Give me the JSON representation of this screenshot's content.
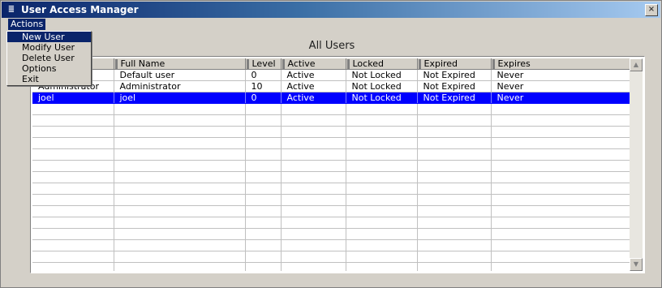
{
  "window": {
    "title": "User Access Manager",
    "close_glyph": "×"
  },
  "menubar": {
    "actions_label": "Actions"
  },
  "dropdown": {
    "items": [
      {
        "label": "New User"
      },
      {
        "label": "Modify User"
      },
      {
        "label": "Delete User"
      },
      {
        "label": "Options"
      },
      {
        "label": "Exit"
      }
    ]
  },
  "main": {
    "section_title": "All Users"
  },
  "table": {
    "columns": [
      "",
      "Full Name",
      "Level",
      "Active",
      "Locked",
      "Expired",
      "Expires"
    ],
    "rows": [
      [
        "",
        "Default user",
        "0",
        "Active",
        "Not Locked",
        "Not Expired",
        "Never"
      ],
      [
        "Administrator",
        "Administrator",
        "10",
        "Active",
        "Not Locked",
        "Not Expired",
        "Never"
      ],
      [
        "joel",
        "joel",
        "0",
        "Active",
        "Not Locked",
        "Not Expired",
        "Never"
      ]
    ],
    "selected_row": 2
  },
  "icons": {
    "app": "app-icon",
    "close": "close-icon",
    "scroll_up": "scroll-up-icon",
    "scroll_down": "scroll-down-icon"
  },
  "colors": {
    "title_start": "#0a246a",
    "title_end": "#a6caf0",
    "selection": "#0000ff",
    "chrome": "#d4d0c8"
  }
}
